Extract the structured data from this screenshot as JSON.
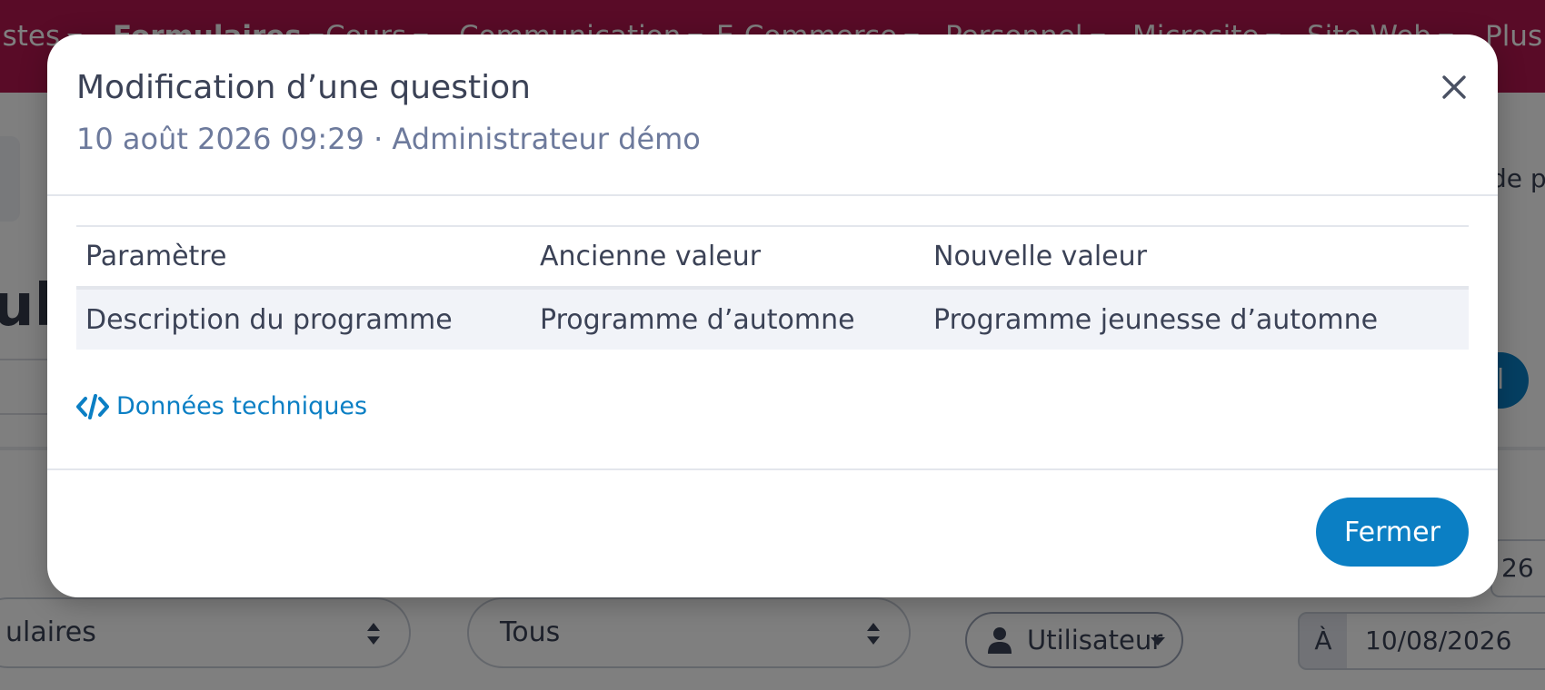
{
  "nav": {
    "items": [
      "istes",
      "Formulaires",
      "Cours",
      "Communication",
      "E-Commerce",
      "Personnel",
      "Microsite",
      "Site Web",
      "Plus"
    ]
  },
  "background": {
    "title_fragment": "ula",
    "right_text": "de p",
    "circle_text": "l",
    "date_fragment": "26",
    "select_forms": "ulaires",
    "select_all": "Tous",
    "user_button": "Utilisateur",
    "date_to_label": "À",
    "date_to_value": "10/08/2026"
  },
  "modal": {
    "title": "Modification d’une question",
    "subtitle": "10 août 2026 09:29 · Administrateur démo",
    "table": {
      "headers": [
        "Paramètre",
        "Ancienne valeur",
        "Nouvelle valeur"
      ],
      "rows": [
        [
          "Description du programme",
          "Programme d’automne",
          "Programme jeunesse d’automne"
        ]
      ]
    },
    "tech_link": "Données techniques",
    "close_button": "Fermer"
  },
  "colors": {
    "nav_bg": "#b3174e",
    "accent": "#0b7fc4",
    "text": "#3b4256",
    "muted": "#6d7a9c"
  }
}
